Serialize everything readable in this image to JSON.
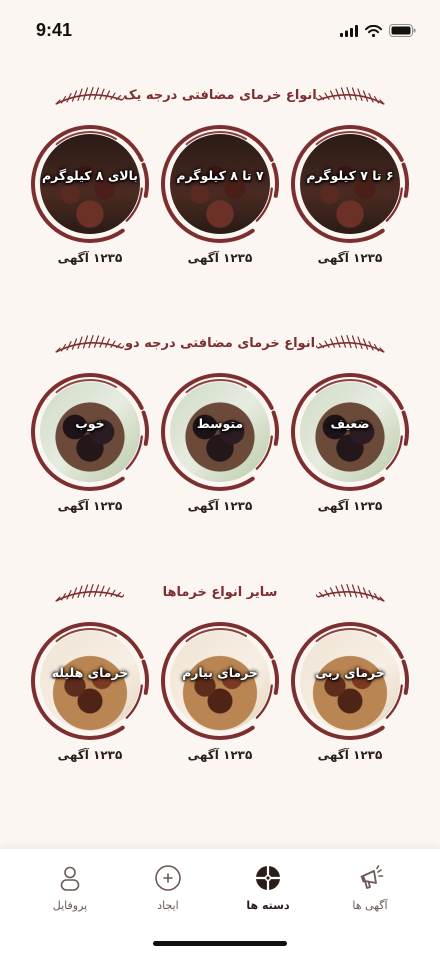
{
  "status_bar": {
    "time": "9:41"
  },
  "sections": [
    {
      "title": "انواع خرمای مضافتی درجه یک",
      "items": [
        {
          "label": "۶ تا ۷ کیلوگرم",
          "count": "۱۲۳۵ آگهی"
        },
        {
          "label": "۷ تا ۸ کیلوگرم",
          "count": "۱۲۳۵ آگهی"
        },
        {
          "label": "بالای ۸ کیلوگرم",
          "count": "۱۲۳۵ آگهی"
        }
      ]
    },
    {
      "title": "انواع خرمای مضافتی درجه دو",
      "items": [
        {
          "label": "ضعیف",
          "count": "۱۲۳۵ آگهی"
        },
        {
          "label": "متوسط",
          "count": "۱۲۳۵ آگهی"
        },
        {
          "label": "خوب",
          "count": "۱۲۳۵ آگهی"
        }
      ]
    },
    {
      "title": "سایر انواع خرماها",
      "items": [
        {
          "label": "خرمای ربی",
          "count": "۱۲۳۵ آگهی"
        },
        {
          "label": "خرمای بیارم",
          "count": "۱۲۳۵ آگهی"
        },
        {
          "label": "خرمای هلیله",
          "count": "۱۲۳۵ آگهی"
        }
      ]
    }
  ],
  "bottom_nav": {
    "items": [
      {
        "label": "آگهی ها",
        "icon": "megaphone-icon"
      },
      {
        "label": "دسته ها",
        "icon": "categories-icon",
        "active": true
      },
      {
        "label": "ایجاد",
        "icon": "plus-circle-icon"
      },
      {
        "label": "پروفایل",
        "icon": "user-icon"
      }
    ]
  },
  "colors": {
    "accent": "#7d2f30",
    "background": "#fbf6f1"
  }
}
